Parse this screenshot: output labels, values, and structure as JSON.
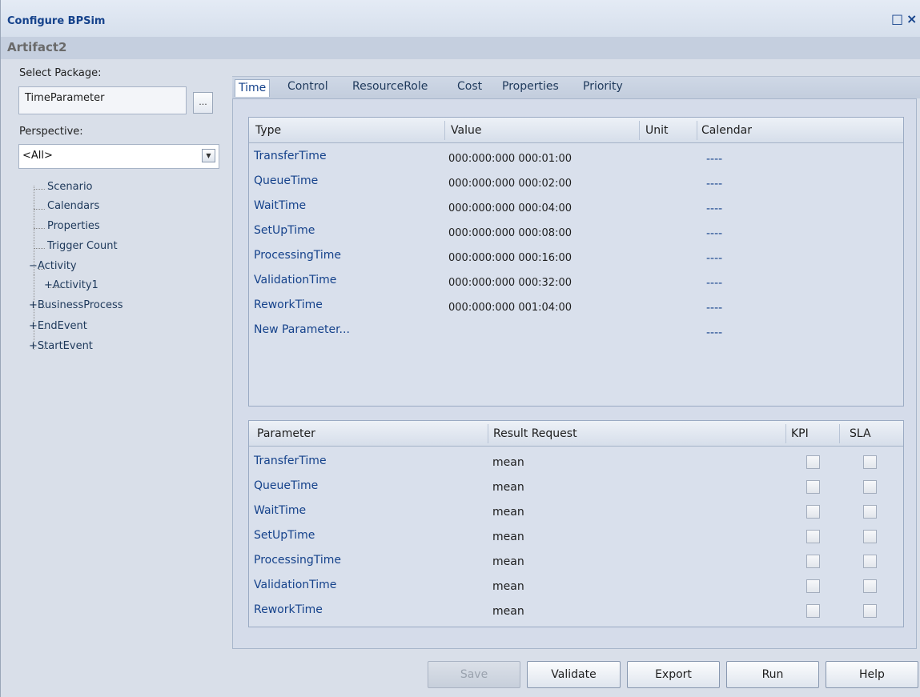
{
  "window": {
    "title": "Configure BPSim",
    "subtitle": "Artifact2",
    "restore_glyph": "□",
    "close_glyph": "×"
  },
  "left_panel": {
    "select_package_label": "Select Package:",
    "package_value": "TimeParameter",
    "browse_button_label": "...",
    "perspective_label": "Perspective:",
    "perspective_value": "<All>",
    "tree": {
      "scenario": "Scenario",
      "calendars": "Calendars",
      "properties": "Properties",
      "trigger_count": "Trigger Count",
      "activity": "Activity",
      "activity1": "Activity1",
      "business_process": "BusinessProcess",
      "end_event": "EndEvent",
      "start_event": "StartEvent"
    }
  },
  "tabs": [
    "Time",
    "Control",
    "ResourceRole",
    "Cost",
    "Properties",
    "Priority"
  ],
  "time_grid": {
    "columns": [
      "Type",
      "Value",
      "Unit",
      "Calendar"
    ],
    "rows": [
      {
        "type": "TransferTime",
        "value": "000:000:000 000:01:00",
        "unit": "",
        "calendar": "----"
      },
      {
        "type": "QueueTime",
        "value": "000:000:000 000:02:00",
        "unit": "",
        "calendar": "----"
      },
      {
        "type": "WaitTime",
        "value": "000:000:000 000:04:00",
        "unit": "",
        "calendar": "----"
      },
      {
        "type": "SetUpTime",
        "value": "000:000:000 000:08:00",
        "unit": "",
        "calendar": "----"
      },
      {
        "type": "ProcessingTime",
        "value": "000:000:000 000:16:00",
        "unit": "",
        "calendar": "----"
      },
      {
        "type": "ValidationTime",
        "value": "000:000:000 000:32:00",
        "unit": "",
        "calendar": "----"
      },
      {
        "type": "ReworkTime",
        "value": "000:000:000 001:04:00",
        "unit": "",
        "calendar": "----"
      },
      {
        "type": "New Parameter...",
        "value": "",
        "unit": "",
        "calendar": "----"
      }
    ]
  },
  "result_grid": {
    "columns": [
      "Parameter",
      "Result Request",
      "KPI",
      "SLA"
    ],
    "rows": [
      {
        "parameter": "TransferTime",
        "result_request": "mean",
        "kpi": false,
        "sla": false
      },
      {
        "parameter": "QueueTime",
        "result_request": "mean",
        "kpi": false,
        "sla": false
      },
      {
        "parameter": "WaitTime",
        "result_request": "mean",
        "kpi": false,
        "sla": false
      },
      {
        "parameter": "SetUpTime",
        "result_request": "mean",
        "kpi": false,
        "sla": false
      },
      {
        "parameter": "ProcessingTime",
        "result_request": "mean",
        "kpi": false,
        "sla": false
      },
      {
        "parameter": "ValidationTime",
        "result_request": "mean",
        "kpi": false,
        "sla": false
      },
      {
        "parameter": "ReworkTime",
        "result_request": "mean",
        "kpi": false,
        "sla": false
      }
    ]
  },
  "buttons": {
    "save": "Save",
    "validate": "Validate",
    "export": "Export",
    "run": "Run",
    "help": "Help"
  }
}
